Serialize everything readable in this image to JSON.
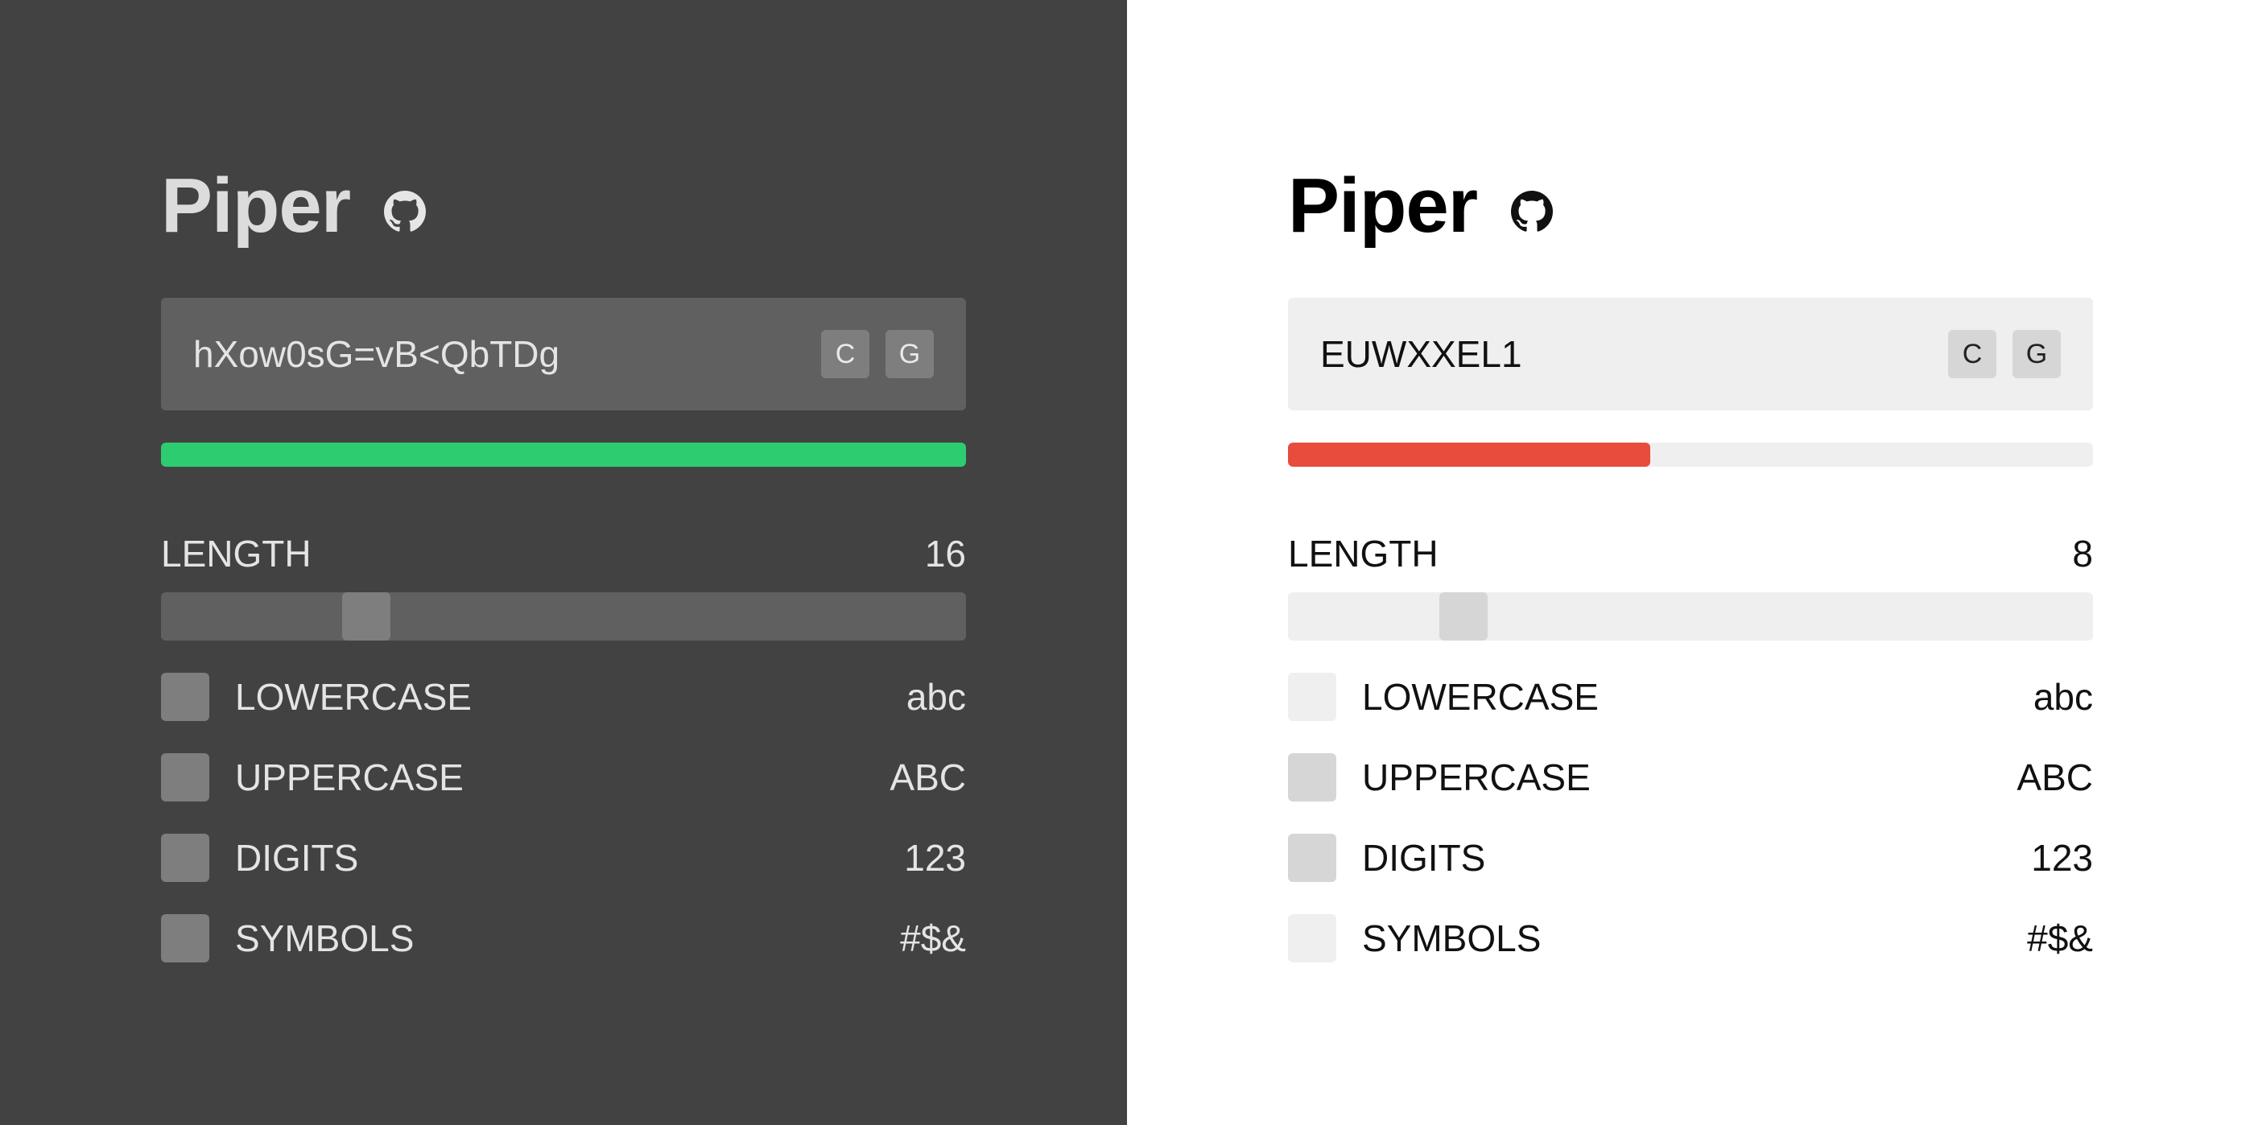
{
  "dark": {
    "app_title": "Piper",
    "icon": "github-icon",
    "password": "hXow0sG=vB<QbTDg",
    "copy_label": "C",
    "generate_label": "G",
    "strength_fraction": 1.0,
    "strength_color": "#2ecc71",
    "length_label": "LENGTH",
    "length_value": "16",
    "length_numeric": 16,
    "options": [
      {
        "label": "LOWERCASE",
        "sample": "abc",
        "checked": true
      },
      {
        "label": "UPPERCASE",
        "sample": "ABC",
        "checked": true
      },
      {
        "label": "DIGITS",
        "sample": "123",
        "checked": true
      },
      {
        "label": "SYMBOLS",
        "sample": "#$&",
        "checked": true
      }
    ]
  },
  "light": {
    "app_title": "Piper",
    "icon": "github-icon",
    "password": "EUWXXEL1",
    "copy_label": "C",
    "generate_label": "G",
    "strength_fraction": 0.45,
    "strength_color": "#e74c3c",
    "length_label": "LENGTH",
    "length_value": "8",
    "length_numeric": 8,
    "options": [
      {
        "label": "LOWERCASE",
        "sample": "abc",
        "checked": false
      },
      {
        "label": "UPPERCASE",
        "sample": "ABC",
        "checked": true
      },
      {
        "label": "DIGITS",
        "sample": "123",
        "checked": true
      },
      {
        "label": "SYMBOLS",
        "sample": "#$&",
        "checked": false
      }
    ]
  },
  "colors": {
    "dark_background": "#424242",
    "light_background": "#ffffff",
    "strong": "#2ecc71",
    "weak": "#e74c3c"
  }
}
